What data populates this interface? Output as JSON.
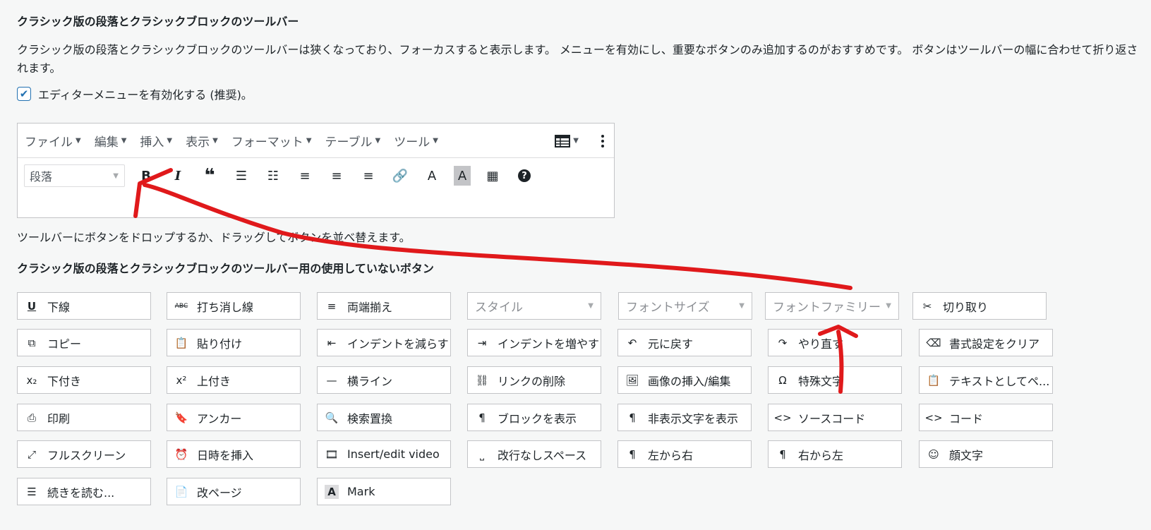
{
  "section_title": "クラシック版の段落とクラシックブロックのツールバー",
  "description": "クラシック版の段落とクラシックブロックのツールバーは狭くなっており、フォーカスすると表示します。 メニューを有効にし、重要なボタンのみ追加するのがおすすめです。 ボタンはツールバーの幅に合わせて折り返されます。",
  "checkbox": {
    "label": "エディターメニューを有効化する (推奨)。",
    "checked": true
  },
  "editor": {
    "menus": [
      "ファイル",
      "編集",
      "挿入",
      "表示",
      "フォーマット",
      "テーブル",
      "ツール"
    ],
    "format_select": "段落",
    "toolbar_buttons": [
      "B",
      "I",
      "❝",
      "☰",
      "☷",
      "≡",
      "≡",
      "≡",
      "🔗",
      "A",
      "A",
      "▦",
      "?"
    ]
  },
  "toolbar_hint": "ツールバーにボタンをドロップするか、ドラッグしてボタンを並べ替えます。",
  "unused_title": "クラシック版の段落とクラシックブロックのツールバー用の使用していないボタン",
  "unused_buttons": [
    {
      "label": "下線",
      "icon": "U"
    },
    {
      "label": "打ち消し線",
      "icon": "ABC"
    },
    {
      "label": "両端揃え",
      "icon": "≡"
    },
    {
      "label": "スタイル",
      "icon": ""
    },
    {
      "label": "フォントサイズ",
      "icon": ""
    },
    {
      "label": "フォントファミリー",
      "icon": ""
    },
    {
      "label": "切り取り",
      "icon": "✂"
    },
    {
      "label": "コピー",
      "icon": "⧉"
    },
    {
      "label": "貼り付け",
      "icon": "📋"
    },
    {
      "label": "インデントを減らす",
      "icon": "⇤"
    },
    {
      "label": "インデントを増やす",
      "icon": "⇥"
    },
    {
      "label": "元に戻す",
      "icon": "↶"
    },
    {
      "label": "やり直す",
      "icon": "↷"
    },
    {
      "label": "書式設定をクリア",
      "icon": "⌫"
    },
    {
      "label": "下付き",
      "icon": "x₂"
    },
    {
      "label": "上付き",
      "icon": "x²"
    },
    {
      "label": "横ライン",
      "icon": "—"
    },
    {
      "label": "リンクの削除",
      "icon": "⛓"
    },
    {
      "label": "画像の挿入/編集",
      "icon": "🖼"
    },
    {
      "label": "特殊文字",
      "icon": "Ω"
    },
    {
      "label": "テキストとしてペ...",
      "icon": "📋"
    },
    {
      "label": "印刷",
      "icon": "⎙"
    },
    {
      "label": "アンカー",
      "icon": "🔖"
    },
    {
      "label": "検索置換",
      "icon": "🔍"
    },
    {
      "label": "ブロックを表示",
      "icon": "¶"
    },
    {
      "label": "非表示文字を表示",
      "icon": "¶"
    },
    {
      "label": "ソースコード",
      "icon": "<>"
    },
    {
      "label": "コード",
      "icon": "<>"
    },
    {
      "label": "フルスクリーン",
      "icon": "⤢"
    },
    {
      "label": "日時を挿入",
      "icon": "⏰"
    },
    {
      "label": "Insert/edit video",
      "icon": "🎞"
    },
    {
      "label": "改行なしスペース",
      "icon": "⎵"
    },
    {
      "label": "左から右",
      "icon": "¶"
    },
    {
      "label": "右から左",
      "icon": "¶"
    },
    {
      "label": "顔文字",
      "icon": "☺"
    },
    {
      "label": "続きを読む...",
      "icon": "☰"
    },
    {
      "label": "改ページ",
      "icon": "📄"
    },
    {
      "label": "Mark",
      "icon": "A"
    }
  ],
  "colors": {
    "accent": "#2271b1",
    "annotation": "#e0191b",
    "border": "#c3c4c7"
  }
}
